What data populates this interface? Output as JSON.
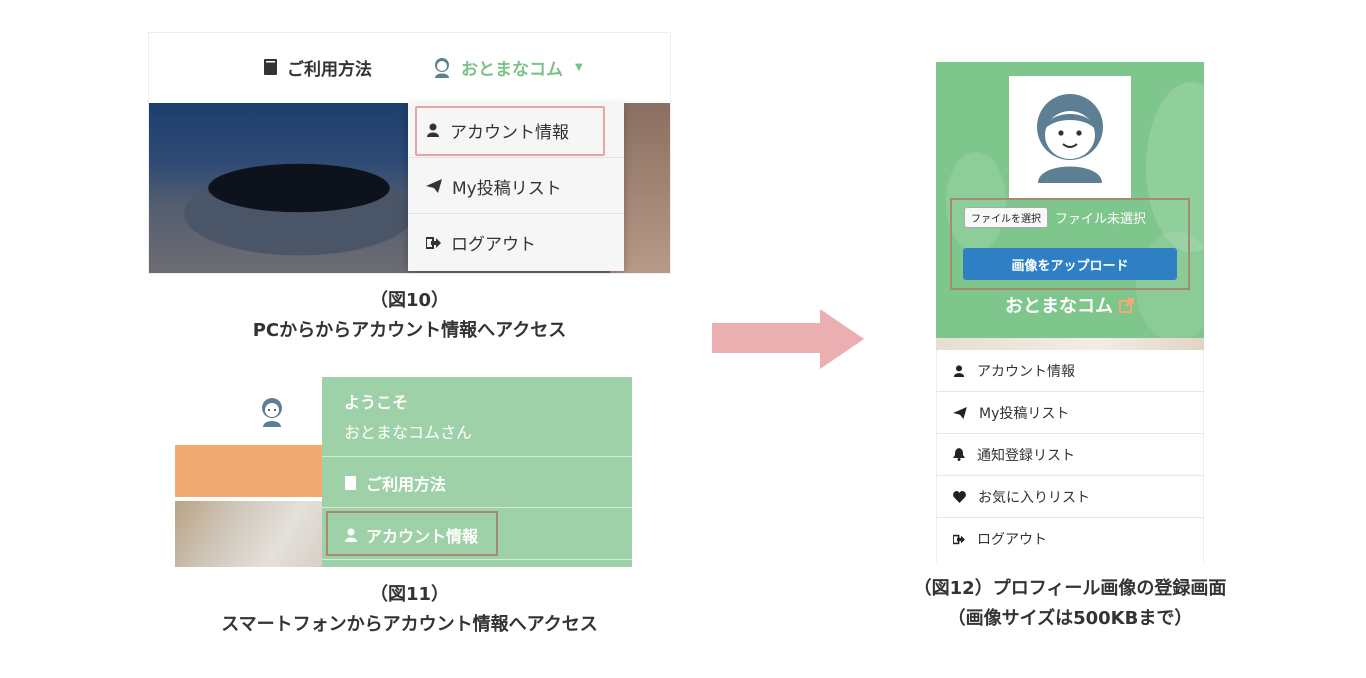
{
  "fig10": {
    "nav_usage": "ご利用方法",
    "nav_user": "おとまなコム",
    "dropdown": [
      "アカウント情報",
      "My投稿リスト",
      "ログアウト"
    ],
    "caption_line1": "（図10）",
    "caption_line2": "PCからからアカウント情報へアクセス"
  },
  "fig11": {
    "welcome": "ようこそ",
    "username": "おとまなコムさん",
    "menu": [
      "ご利用方法",
      "アカウント情報"
    ],
    "caption_line1": "（図11）",
    "caption_line2": "スマートフォンからアカウント情報へアクセス"
  },
  "fig12": {
    "file_button": "ファイルを選択",
    "file_status": "ファイル未選択",
    "upload_button": "画像をアップロード",
    "profile_name": "おとまなコム",
    "menu": [
      "アカウント情報",
      "My投稿リスト",
      "通知登録リスト",
      "お気に入りリスト",
      "ログアウト"
    ],
    "caption_line1": "（図12）プロフィール画像の登録画面",
    "caption_line2": "（画像サイズは500KBまで）"
  },
  "colors": {
    "green_header": "#7cc287",
    "green_panel": "#9ed1a7",
    "highlight_pink": "#e6a3a8",
    "highlight_brown": "#a58a72",
    "arrow": "#ebaeb1",
    "upload_blue": "#2e7fc4"
  },
  "icons": {
    "book": "book-icon",
    "user_avatar": "avatar-icon",
    "user": "user-icon",
    "paper_plane": "paper-plane-icon",
    "sign_out": "sign-out-icon",
    "bell": "bell-icon",
    "heart": "heart-icon",
    "external_link": "external-link-icon",
    "caret": "caret-down-icon",
    "arrow_right": "arrow-right-icon"
  }
}
